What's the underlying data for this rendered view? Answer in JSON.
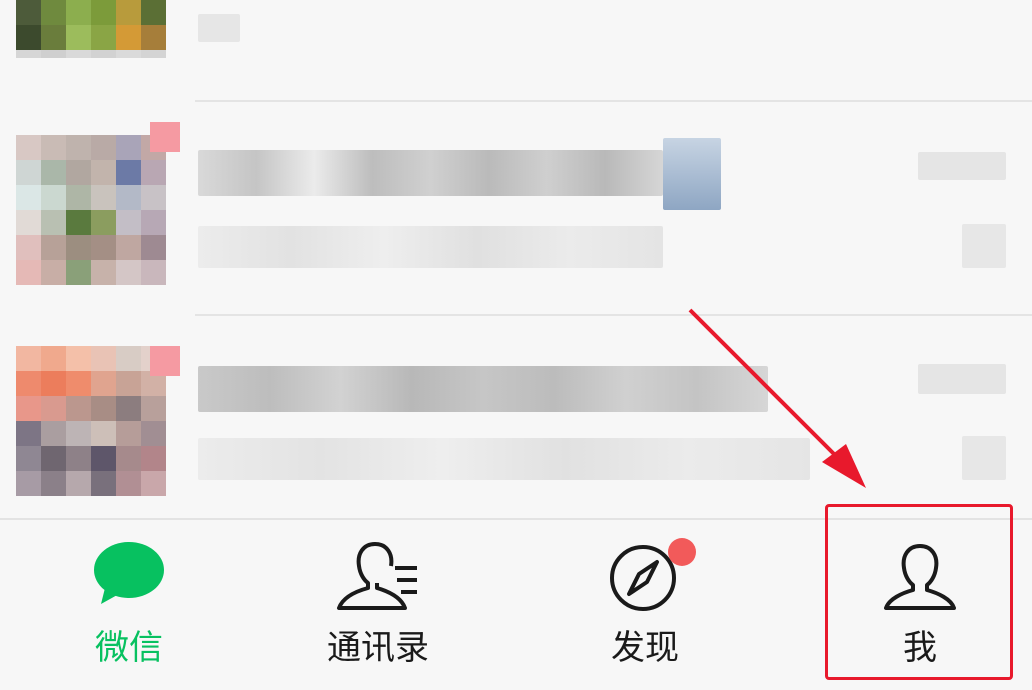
{
  "tabbar": {
    "tabs": [
      {
        "label": "微信",
        "icon": "chat-bubble-icon",
        "active": true
      },
      {
        "label": "通讯录",
        "icon": "contacts-icon",
        "active": false
      },
      {
        "label": "发现",
        "icon": "compass-icon",
        "active": false
      },
      {
        "label": "我",
        "icon": "person-icon",
        "active": false
      }
    ]
  },
  "colors": {
    "accent": "#07c160",
    "badge": "#f25a5a",
    "annotation": "#e8192c"
  }
}
